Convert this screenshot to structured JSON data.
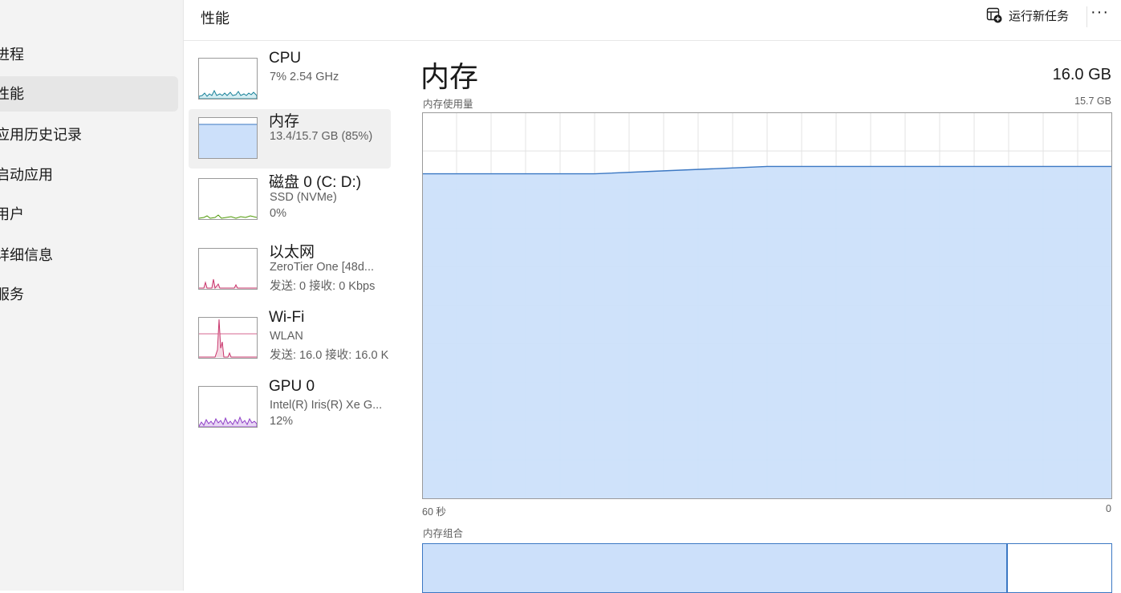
{
  "nav": {
    "items": [
      {
        "label": "进程"
      },
      {
        "label": "性能",
        "active": true
      },
      {
        "label": "应用历史记录"
      },
      {
        "label": "启动应用"
      },
      {
        "label": "用户"
      },
      {
        "label": "详细信息"
      },
      {
        "label": "服务"
      }
    ]
  },
  "header": {
    "title": "性能",
    "run_task_label": "运行新任务",
    "more_label": "···",
    "run_task_icon": "add-window-icon"
  },
  "resources": [
    {
      "name": "CPU",
      "line1": "7% 2.54 GHz",
      "line2": "",
      "color": "#1a8299",
      "icon": "cpu-graph"
    },
    {
      "name": "内存",
      "line1": "13.4/15.7 GB (85%)",
      "line2": "",
      "color": "#3c78c3",
      "selected": true
    },
    {
      "name": "磁盘 0 (C: D:)",
      "line1": "SSD (NVMe)",
      "line2": "0%",
      "color": "#4e9a06"
    },
    {
      "name": "以太网",
      "line1": "ZeroTier One [48d...",
      "line2": "发送: 0 接收: 0 Kbps",
      "color": "#c8356b"
    },
    {
      "name": "Wi-Fi",
      "line1": "WLAN",
      "line2": "发送: 16.0 接收: 16.0 K",
      "color": "#c8356b"
    },
    {
      "name": "GPU 0",
      "line1": "Intel(R) Iris(R) Xe G...",
      "line2": "12%",
      "color": "#8f3fc6"
    }
  ],
  "detail": {
    "title": "内存",
    "total": "16.0 GB",
    "usage_label": "内存使用量",
    "usage_max": "15.7 GB",
    "time_left": "60 秒",
    "time_right": "0",
    "composition_label": "内存组合",
    "composition_used_fraction": 0.85,
    "accent": "#3c78c3",
    "fill": "#cce0fa"
  },
  "chart_data": {
    "type": "area",
    "x": [
      60,
      55,
      50,
      45,
      40,
      35,
      30,
      25,
      20,
      15,
      10,
      5,
      0
    ],
    "values": [
      13.2,
      13.2,
      13.2,
      13.2,
      13.3,
      13.4,
      13.5,
      13.5,
      13.5,
      13.5,
      13.5,
      13.5,
      13.5
    ],
    "ylim": [
      0,
      15.7
    ],
    "grid": true
  }
}
